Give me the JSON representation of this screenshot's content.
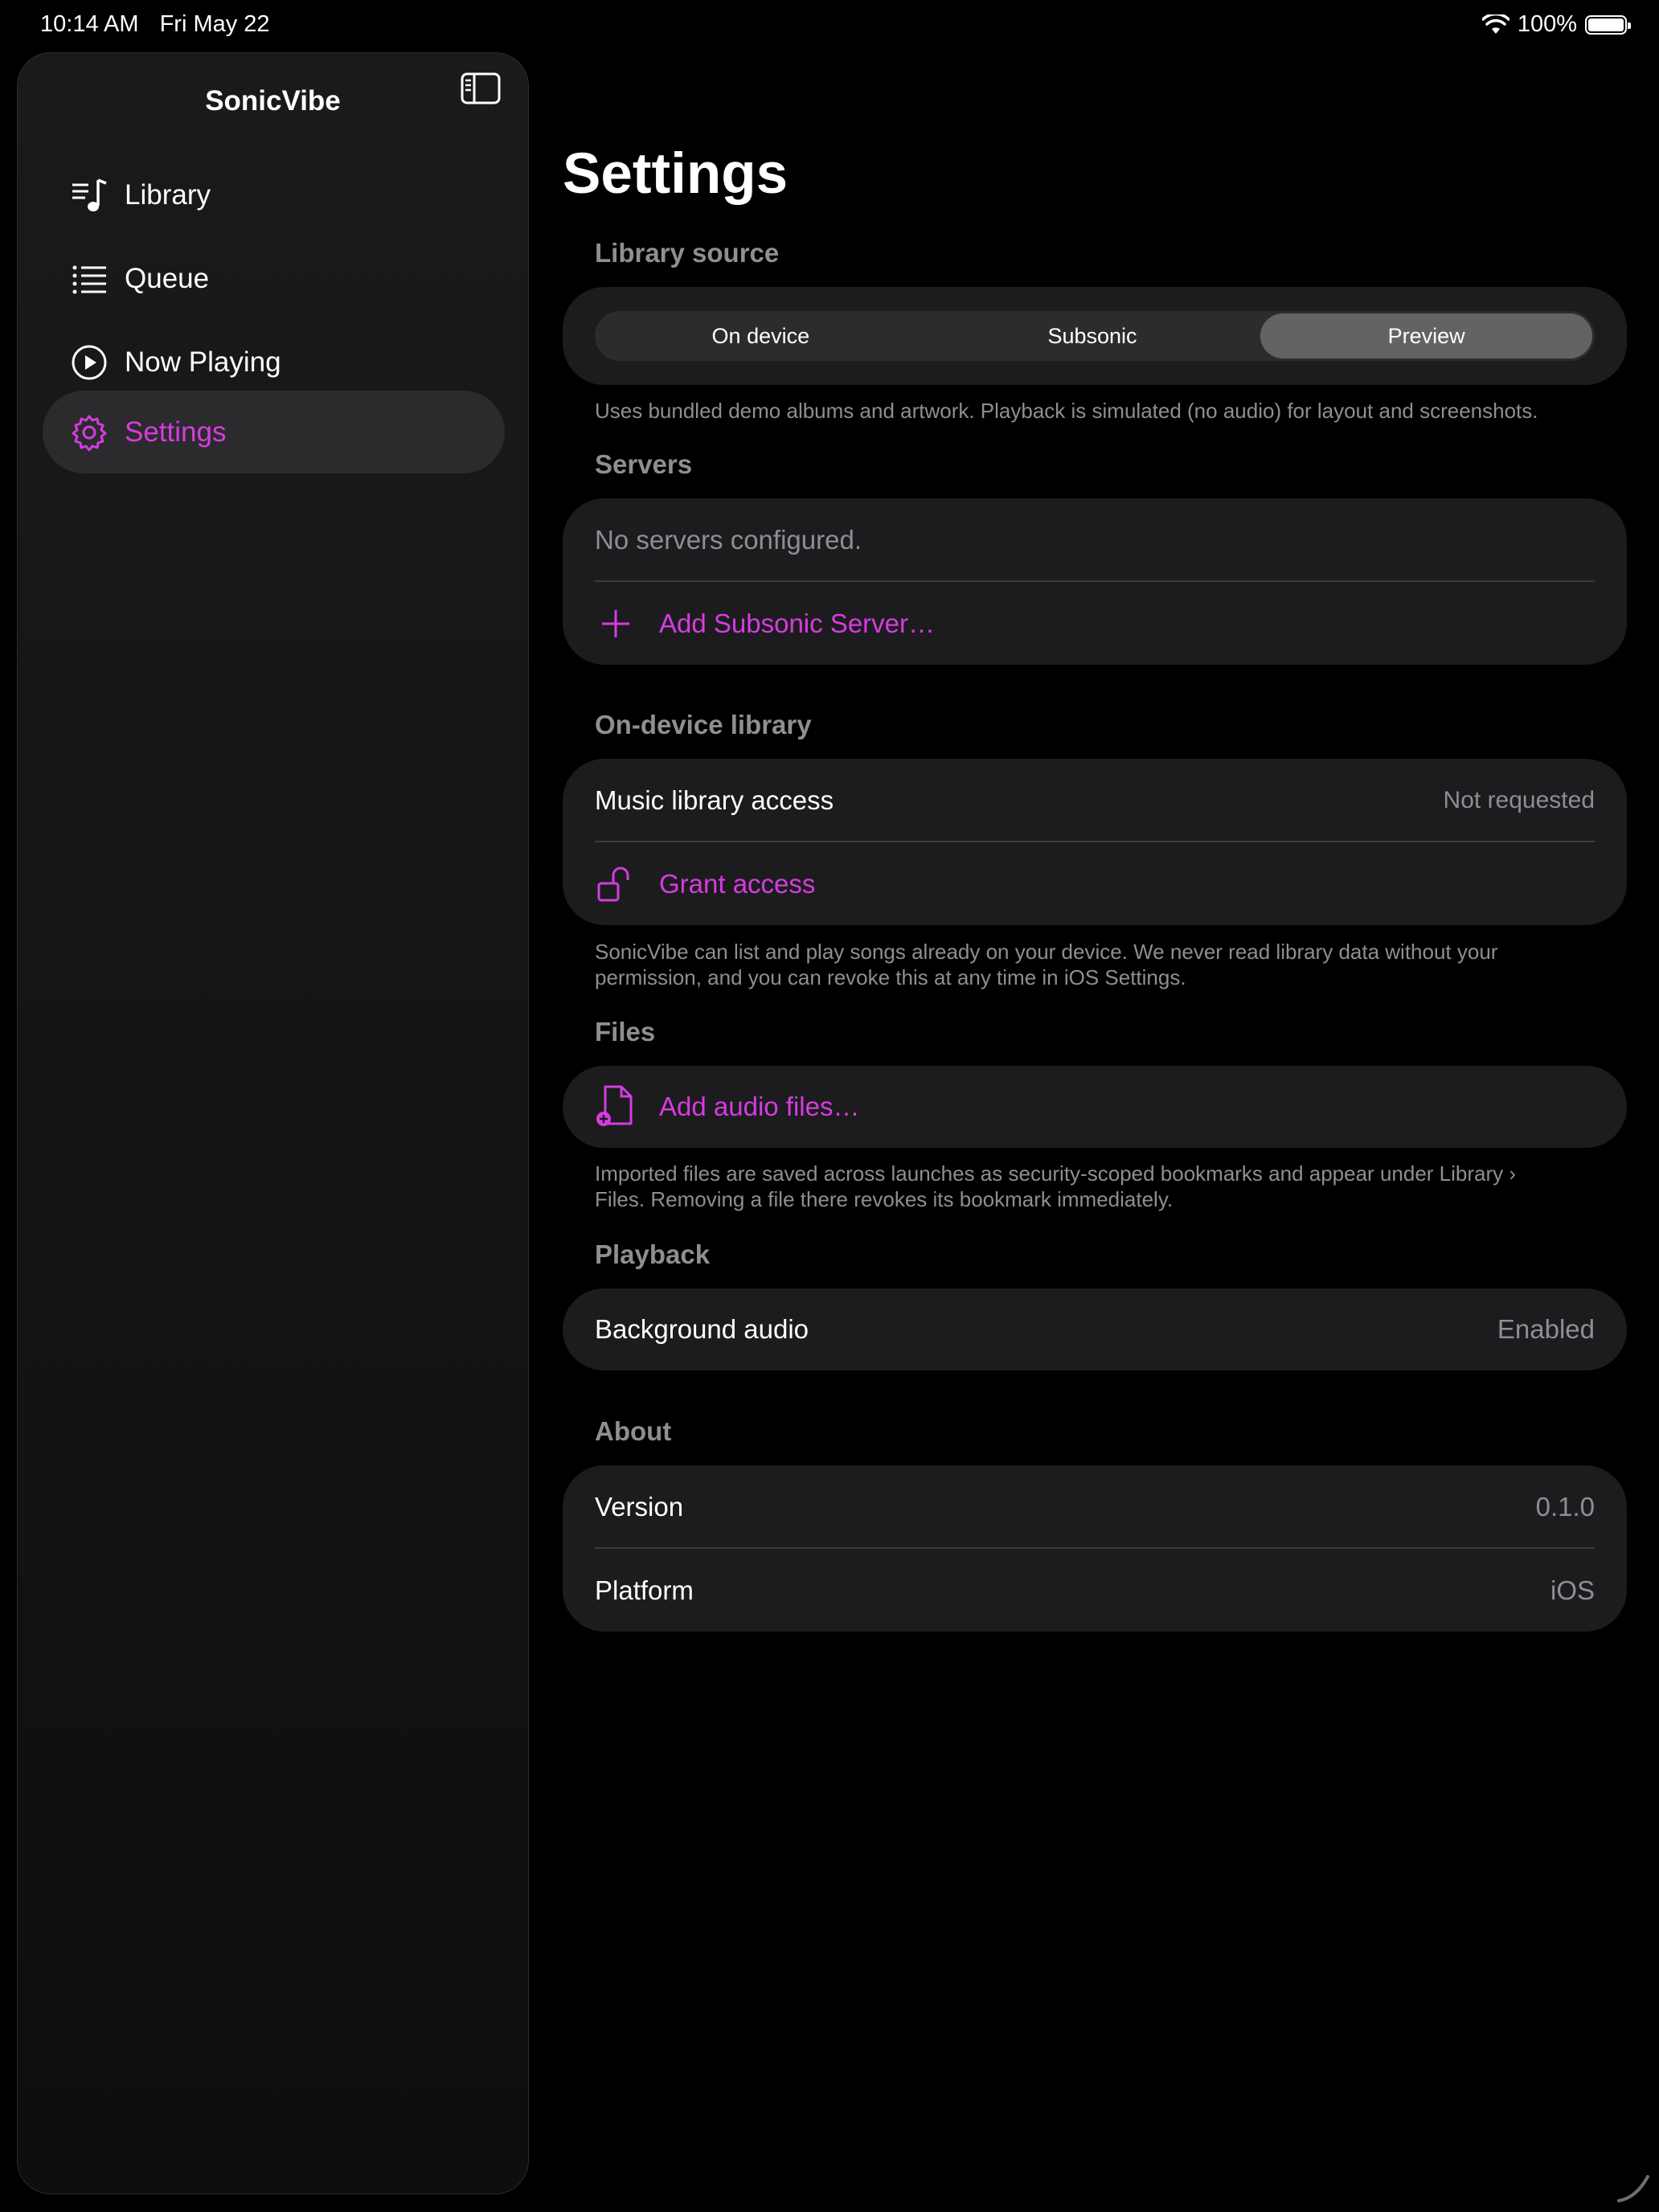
{
  "status_bar": {
    "time": "10:14 AM",
    "date": "Fri May 22",
    "battery": "100%"
  },
  "sidebar": {
    "title": "SonicVibe",
    "items": [
      {
        "label": "Library",
        "icon": "music-list-icon"
      },
      {
        "label": "Queue",
        "icon": "list-icon"
      },
      {
        "label": "Now Playing",
        "icon": "play-circle-icon"
      },
      {
        "label": "Settings",
        "icon": "gear-icon",
        "active": true
      }
    ]
  },
  "main": {
    "title": "Settings",
    "library_source": {
      "header": "Library source",
      "options": [
        "On device",
        "Subsonic",
        "Preview"
      ],
      "selected": "Preview",
      "note": "Uses bundled demo albums and artwork. Playback is simulated (no audio) for layout and screenshots."
    },
    "servers": {
      "header": "Servers",
      "empty_text": "No servers configured.",
      "add_label": "Add Subsonic Server…"
    },
    "on_device": {
      "header": "On-device library",
      "access_label": "Music library access",
      "access_value": "Not requested",
      "grant_label": "Grant access",
      "note_line1": "SonicVibe can list and play songs already on your device. We never read library data without your",
      "note_line2": "permission, and you can revoke this at any time in iOS Settings."
    },
    "files": {
      "header": "Files",
      "add_label": "Add audio files…",
      "note_line1": "Imported files are saved across launches as security-scoped bookmarks and appear under Library ›",
      "note_line2": "Files. Removing a file there revokes its bookmark immediately."
    },
    "playback": {
      "header": "Playback",
      "bg_label": "Background audio",
      "bg_value": "Enabled"
    },
    "about": {
      "header": "About",
      "version_label": "Version",
      "version_value": "0.1.0",
      "platform_label": "Platform",
      "platform_value": "iOS"
    }
  },
  "colors": {
    "accent": "#d63ce0",
    "background": "#000000",
    "card": "#1c1c1e",
    "secondary_text": "#8e8e93"
  }
}
